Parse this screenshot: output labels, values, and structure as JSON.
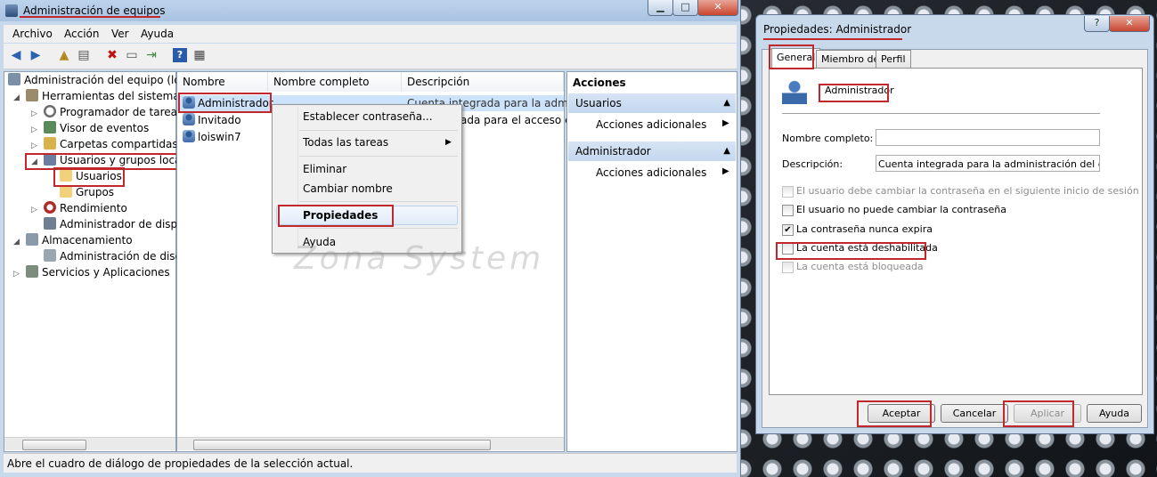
{
  "mmc": {
    "title": "Administración de equipos",
    "menu": [
      "Archivo",
      "Acción",
      "Ver",
      "Ayuda"
    ],
    "tree": [
      {
        "label": "Administración del equipo (loc"
      },
      {
        "label": "Herramientas del sistema"
      },
      {
        "label": "Programador de tareas"
      },
      {
        "label": "Visor de eventos"
      },
      {
        "label": "Carpetas compartidas"
      },
      {
        "label": "Usuarios y grupos locale"
      },
      {
        "label": "Usuarios"
      },
      {
        "label": "Grupos"
      },
      {
        "label": "Rendimiento"
      },
      {
        "label": "Administrador de dispo"
      },
      {
        "label": "Almacenamiento"
      },
      {
        "label": "Administración de disco"
      },
      {
        "label": "Servicios y Aplicaciones"
      }
    ],
    "columns": [
      "Nombre",
      "Nombre completo",
      "Descripción"
    ],
    "rows": [
      {
        "name": "Administrador",
        "full": "",
        "desc": "Cuenta integrada para la adminis"
      },
      {
        "name": "Invitado",
        "full": "",
        "desc": "ada para el acceso c"
      },
      {
        "name": "loiswin7",
        "full": "",
        "desc": ""
      }
    ],
    "context_menu": [
      "Establecer contraseña...",
      "Todas las tareas",
      "Eliminar",
      "Cambiar nombre",
      "Propiedades",
      "Ayuda"
    ],
    "actions": {
      "header": "Acciones",
      "sections": [
        {
          "title": "Usuarios",
          "item": "Acciones adicionales"
        },
        {
          "title": "Administrador",
          "item": "Acciones adicionales"
        }
      ]
    },
    "status": "Abre el cuadro de diálogo de propiedades de la selección actual.",
    "watermark": "Zona System"
  },
  "dialog": {
    "title": "Propiedades: Administrador",
    "tabs": [
      "General",
      "Miembro de",
      "Perfil"
    ],
    "user": "Administrador",
    "full_name_label": "Nombre completo:",
    "full_name_value": "",
    "desc_label": "Descripción:",
    "desc_value": "Cuenta integrada para la administración del equipo",
    "checks": [
      {
        "label": "El usuario debe cambiar la contraseña en el siguiente inicio de sesión",
        "checked": false,
        "disabled": true
      },
      {
        "label": "El usuario no puede cambiar la contraseña",
        "checked": false,
        "disabled": false
      },
      {
        "label": "La contraseña nunca expira",
        "checked": true,
        "disabled": false
      },
      {
        "label": "La cuenta está deshabilitada",
        "checked": false,
        "disabled": false
      },
      {
        "label": "La cuenta está bloqueada",
        "checked": false,
        "disabled": true
      }
    ],
    "buttons": {
      "ok": "Aceptar",
      "cancel": "Cancelar",
      "apply": "Aplicar",
      "help": "Ayuda"
    },
    "help_glyph": "?",
    "close_glyph": "✕"
  }
}
